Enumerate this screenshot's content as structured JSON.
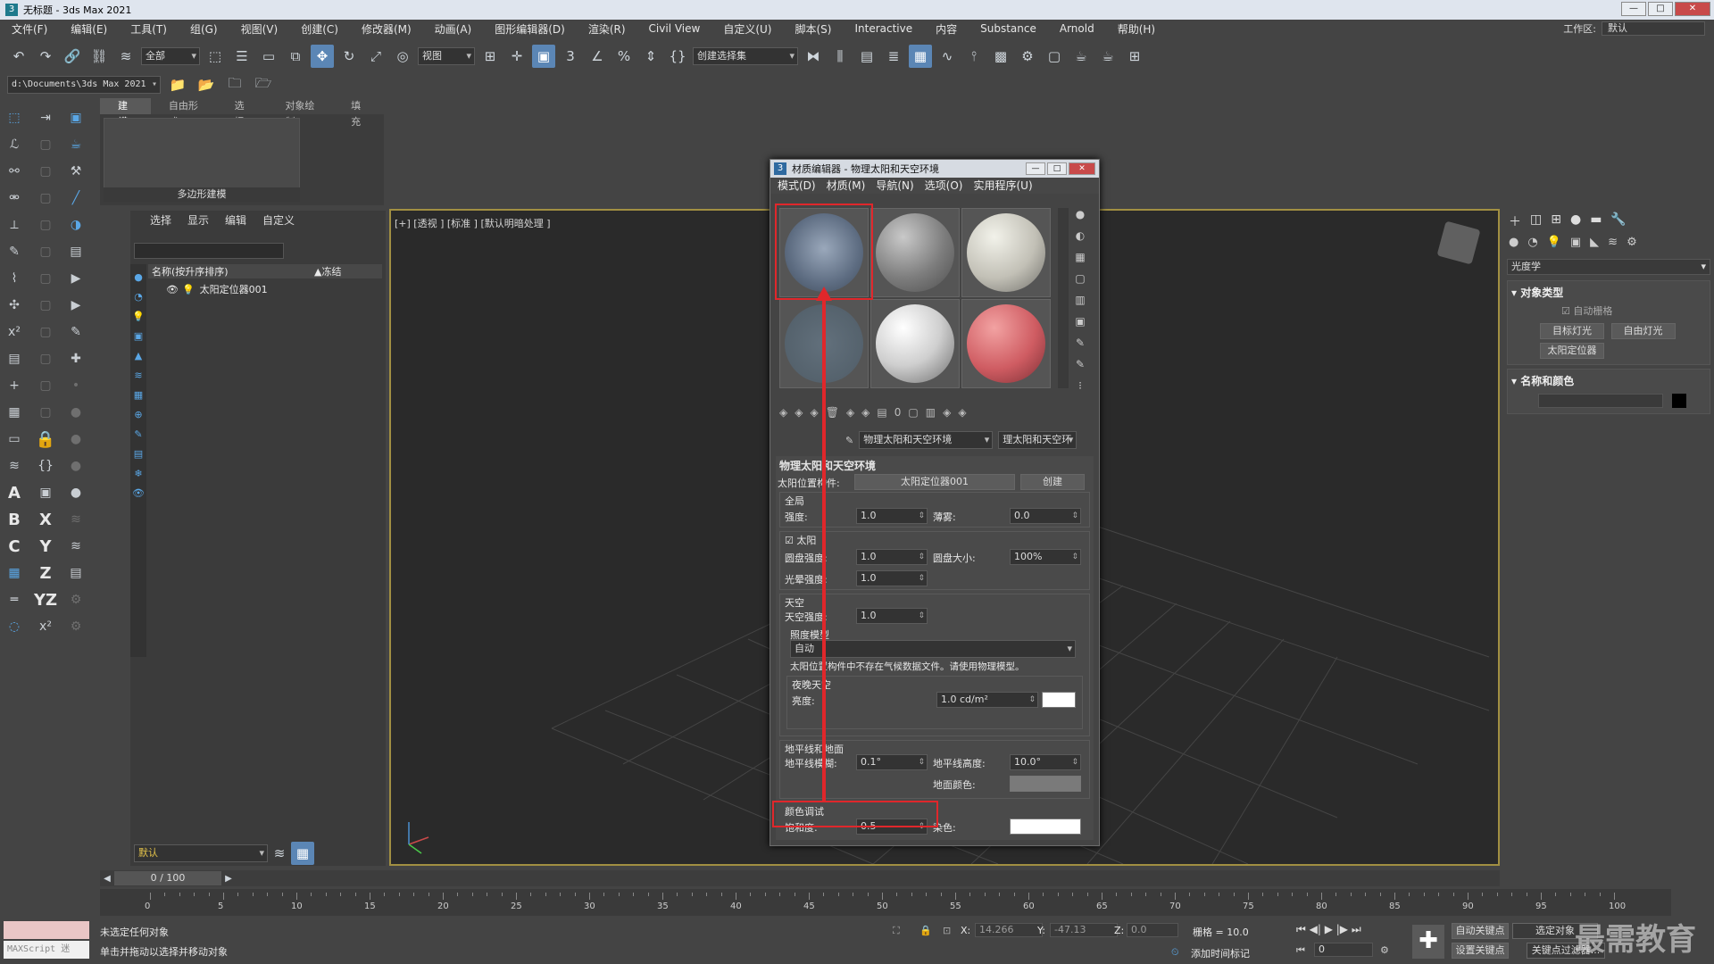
{
  "window": {
    "title": "无标题 - 3ds Max 2021"
  },
  "menu": [
    "文件(F)",
    "编辑(E)",
    "工具(T)",
    "组(G)",
    "视图(V)",
    "创建(C)",
    "修改器(M)",
    "动画(A)",
    "图形编辑器(D)",
    "渲染(R)",
    "Civil View",
    "自定义(U)",
    "脚本(S)",
    "Interactive",
    "内容",
    "Substance",
    "Arnold",
    "帮助(H)"
  ],
  "workspace": {
    "label": "工作区:",
    "value": "默认"
  },
  "toolbar": {
    "filter": "全部",
    "refcoord": "视图",
    "selset": "创建选择集"
  },
  "project_path": "d:\\Documents\\3ds Max 2021",
  "ribbon": {
    "tabs": [
      "建模",
      "自由形式",
      "选择",
      "对象绘制",
      "填充"
    ],
    "panel_label": "多边形建模"
  },
  "explorer": {
    "tabs": [
      "选择",
      "显示",
      "编辑",
      "自定义"
    ],
    "col_name": "名称(按升序排序)",
    "col_freeze": "▲冻结",
    "rows": [
      {
        "name": "太阳定位器001"
      }
    ],
    "layer": "默认"
  },
  "viewport": {
    "label": "[+] [透视 ] [标准 ] [默认明暗处理 ]"
  },
  "mat_editor": {
    "title": "材质编辑器 - 物理太阳和天空环境",
    "menu": [
      "模式(D)",
      "材质(M)",
      "导航(N)",
      "选项(O)",
      "实用程序(U)"
    ],
    "material_name": "物理太阳和天空环境",
    "material_type": "理太阳和天空环",
    "rollout_title": "物理太阳和天空环境",
    "sun_pos_label": "太阳位置构件:",
    "sun_pos_value": "太阳定位器001",
    "create_btn": "创建",
    "global": "全局",
    "intensity_label": "强度:",
    "intensity": "1.0",
    "haze_label": "薄雾:",
    "haze": "0.0",
    "sun": "太阳",
    "disk_intensity_label": "圆盘强度:",
    "disk_intensity": "1.0",
    "disk_size_label": "圆盘大小:",
    "disk_size": "100%",
    "glow_label": "光晕强度:",
    "glow": "1.0",
    "sky": "天空",
    "sky_intensity_label": "天空强度:",
    "sky_intensity": "1.0",
    "illum_model_label": "照度模型",
    "illum_model": "自动",
    "warning": "太阳位置构件中不存在气候数据文件。请使用物理模型。",
    "night_sky": "夜晚天空",
    "brightness_label": "亮度:",
    "brightness": "1.0 cd/m²",
    "horizon_ground": "地平线和地面",
    "horizon_blur_label": "地平线模糊:",
    "horizon_blur": "0.1°",
    "horizon_height_label": "地平线高度:",
    "horizon_height": "10.0°",
    "ground_color_label": "地面颜色:",
    "color_tuning": "颜色调试",
    "saturation_label": "饱和度:",
    "saturation": "0.5",
    "tint_label": "染色:"
  },
  "cmd_panel": {
    "category": "光度学",
    "obj_type": "对象类型",
    "auto_grid": "自动栅格",
    "buttons": [
      "目标灯光",
      "自由灯光",
      "太阳定位器"
    ],
    "name_color": "名称和颜色"
  },
  "timeline": {
    "frame": "0 / 100",
    "ticks": [
      "0",
      "5",
      "10",
      "15",
      "20",
      "25",
      "30",
      "35",
      "40",
      "45",
      "50",
      "55",
      "60",
      "65",
      "70",
      "75",
      "80",
      "85",
      "90",
      "95",
      "100"
    ]
  },
  "status": {
    "maxscript": "MAXScript 迷",
    "line1": "未选定任何对象",
    "line2": "单击并拖动以选择并移动对象",
    "x": "14.266",
    "y": "-47.13",
    "z": "0.0",
    "grid": "栅格 = 10.0",
    "add_marker": "添加时间标记",
    "auto_key": "自动关键点",
    "set_key": "设置关键点",
    "sel_obj": "选定对象",
    "key_filter": "关键点过滤器...",
    "frame_value": "0",
    "watermark": "最需教育"
  }
}
